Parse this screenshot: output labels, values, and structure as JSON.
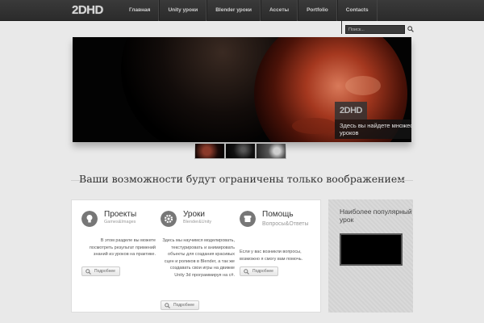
{
  "header": {
    "logo": "2DHD",
    "nav": [
      "Главная",
      "Unity уроки",
      "Blender уроки",
      "Ассеты",
      "Portfolio",
      "Contacts"
    ]
  },
  "search": {
    "placeholder": "Поиск..."
  },
  "slider": {
    "caption_logo": "2DHD",
    "caption_text": "Здесь вы найдете множество инновационных уроков"
  },
  "headline": "Ваши возможности будут ограничены только воображением",
  "features": [
    {
      "title": "Проекты",
      "subtitle": "Games&Images",
      "text": "В этом разделе вы можете посмотреть результат примений знаний из уроков на практике.",
      "button": "Подробнее",
      "icon": "lightbulb-icon"
    },
    {
      "title": "Уроки",
      "subtitle": "Blender&Unity",
      "text": "Здесь мы научимся моделировать, текстурировать и анимировать объекты для создания красивых сцен и роликов в Blender, а так же создавать свои игры на движке Unity 3d программируя на c#.",
      "button": "Подробнее",
      "icon": "gear-icon"
    },
    {
      "title": "Помощь",
      "subtitle": "Вопросы&Ответы",
      "text": "Если у вас возникли вопросы, возможно я смогу вам помочь.",
      "button": "Подробнее",
      "icon": "phone-icon"
    }
  ],
  "popular": {
    "title": "Наиболее популярный урок"
  }
}
